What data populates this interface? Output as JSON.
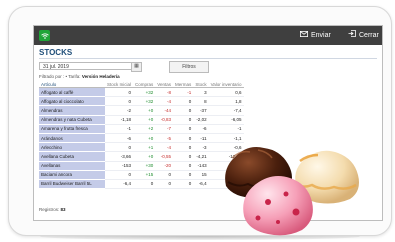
{
  "topbar": {
    "send_label": "Enviar",
    "close_label": "Cerrar",
    "logo_color": "#1fa538",
    "bar_color": "#3f3f3f"
  },
  "page": {
    "title": "STOCKS",
    "date": "31 jul. 2019",
    "filter_button": "Filtros",
    "filter_label": "Filtrado por :",
    "filter_key": "Tarifa:",
    "filter_value": "Versión Heladería"
  },
  "table": {
    "columns": [
      "Artículo",
      "Stock Inicial",
      "Compras",
      "Ventas",
      "Mermas",
      "Stock",
      "Valor inventario"
    ],
    "rows": [
      [
        "Affogato al caffè",
        "0",
        "+32",
        "-8",
        "-1",
        "3",
        "0,6"
      ],
      [
        "Affogato al cioccolato",
        "0",
        "+32",
        "-4",
        "0",
        "8",
        "1,8"
      ],
      [
        "Almendras",
        "-2",
        "+0",
        "-44",
        "0",
        "-37",
        "-7,4"
      ],
      [
        "Almendras y nata Cubeta",
        "-1,18",
        "+0",
        "-0,83",
        "0",
        "-2,02",
        "-6,05"
      ],
      [
        "Amarena y frutta fresca",
        "-1",
        "+2",
        "-7",
        "0",
        "-6",
        "-1"
      ],
      [
        "Arándanos",
        "-6",
        "+0",
        "-5",
        "0",
        "-11",
        "-1,1"
      ],
      [
        "Arlecchino",
        "0",
        "+1",
        "-4",
        "0",
        "-3",
        "-0,6"
      ],
      [
        "Avellana Cubeta",
        "-3,66",
        "+0",
        "-0,55",
        "0",
        "-4,21",
        "-12,63"
      ],
      [
        "Avellanas",
        "-153",
        "+30",
        "-20",
        "0",
        "-143",
        "-28,6"
      ],
      [
        "Baciami ancora",
        "0",
        "+15",
        "0",
        "0",
        "15",
        "3"
      ],
      [
        "Barril Budweiser Barril 5L",
        "-6,4",
        "0",
        "0",
        "0",
        "-6,4",
        "-12,8"
      ]
    ],
    "row_color_classes": [
      [
        "",
        "",
        "g",
        "r",
        "r",
        "",
        ""
      ],
      [
        "",
        "",
        "g",
        "r",
        "",
        "",
        ""
      ],
      [
        "",
        "",
        "g",
        "r",
        "",
        "",
        ""
      ],
      [
        "",
        "",
        "g",
        "r",
        "",
        "",
        ""
      ],
      [
        "",
        "",
        "g",
        "r",
        "",
        "",
        ""
      ],
      [
        "",
        "",
        "g",
        "r",
        "",
        "",
        ""
      ],
      [
        "",
        "",
        "g",
        "r",
        "",
        "",
        ""
      ],
      [
        "",
        "",
        "g",
        "r",
        "",
        "",
        ""
      ],
      [
        "",
        "",
        "g",
        "r",
        "",
        "",
        ""
      ],
      [
        "",
        "",
        "g",
        "",
        "",
        "",
        ""
      ],
      [
        "",
        "",
        "",
        "",
        "",
        "",
        ""
      ]
    ]
  },
  "footer": {
    "label": "Registros:",
    "count": "83"
  },
  "colors": {
    "accent": "#1f4e79",
    "article_cell": "#c4cbe8",
    "positive": "#1e8c2e",
    "negative": "#c52b2b"
  }
}
